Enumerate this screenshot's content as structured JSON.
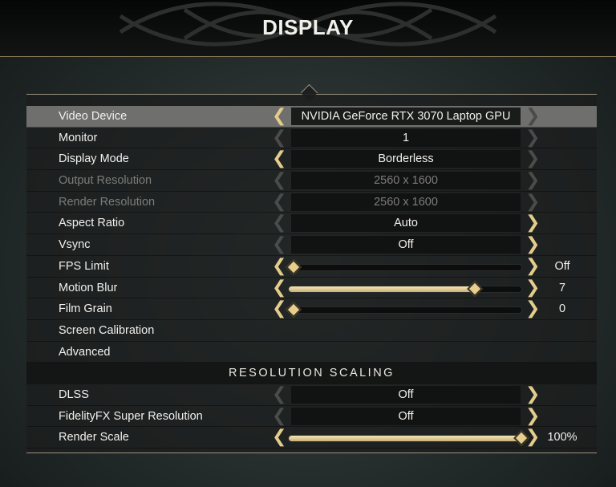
{
  "header": {
    "title": "DISPLAY"
  },
  "rows": [
    {
      "label": "Video Device",
      "type": "select",
      "value": "NVIDIA GeForce RTX 3070 Laptop GPU",
      "left": true,
      "right": false,
      "disabled": false,
      "selected": true
    },
    {
      "label": "Monitor",
      "type": "select",
      "value": "1",
      "left": false,
      "right": false,
      "disabled": false
    },
    {
      "label": "Display Mode",
      "type": "select",
      "value": "Borderless",
      "left": true,
      "right": false,
      "disabled": false
    },
    {
      "label": "Output Resolution",
      "type": "select",
      "value": "2560 x 1600",
      "left": false,
      "right": false,
      "disabled": true
    },
    {
      "label": "Render Resolution",
      "type": "select",
      "value": "2560 x 1600",
      "left": false,
      "right": false,
      "disabled": true
    },
    {
      "label": "Aspect Ratio",
      "type": "select",
      "value": "Auto",
      "left": false,
      "right": true,
      "disabled": false
    },
    {
      "label": "Vsync",
      "type": "select",
      "value": "Off",
      "left": false,
      "right": true,
      "disabled": false
    },
    {
      "label": "FPS Limit",
      "type": "slider",
      "level": 0,
      "display": "Off",
      "left": true,
      "right": true
    },
    {
      "label": "Motion Blur",
      "type": "slider",
      "level": 0.8,
      "display": "7",
      "left": true,
      "right": true
    },
    {
      "label": "Film Grain",
      "type": "slider",
      "level": 0,
      "display": "0",
      "left": true,
      "right": true
    },
    {
      "label": "Screen Calibration",
      "type": "link"
    },
    {
      "label": "Advanced",
      "type": "link"
    },
    {
      "label": "RESOLUTION SCALING",
      "type": "section"
    },
    {
      "label": "DLSS",
      "type": "select",
      "value": "Off",
      "left": false,
      "right": true,
      "disabled": false
    },
    {
      "label": "FidelityFX Super Resolution",
      "type": "select",
      "value": "Off",
      "left": false,
      "right": true,
      "disabled": false
    },
    {
      "label": "Render Scale",
      "type": "slider",
      "level": 1.0,
      "display": "100%",
      "left": true,
      "right": true
    }
  ]
}
